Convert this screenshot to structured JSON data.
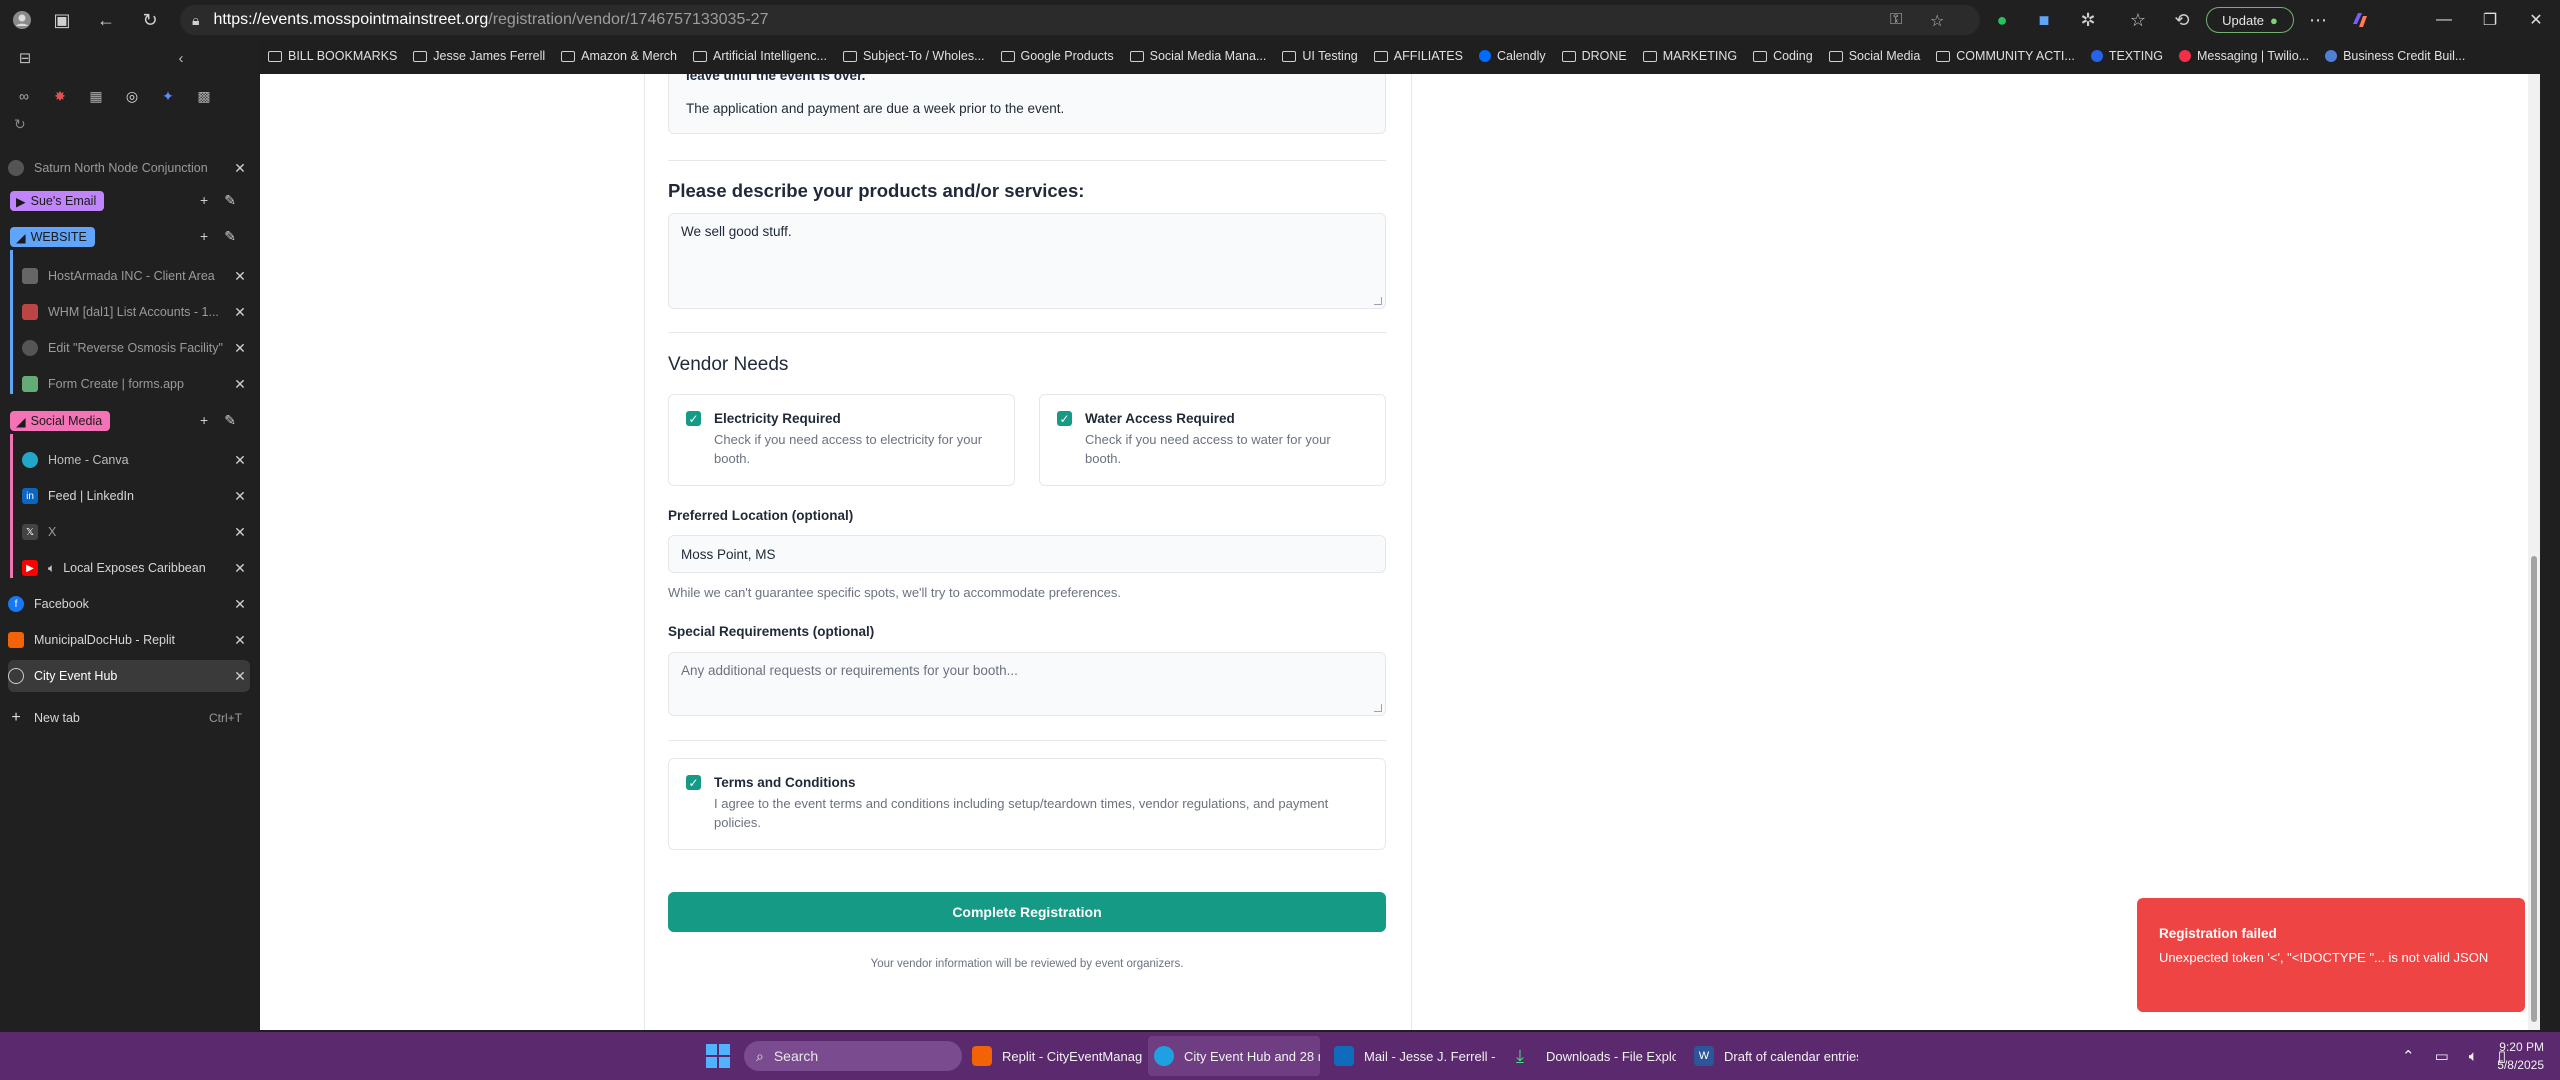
{
  "browser": {
    "url_host": "https://events.mosspointmainstreet.org",
    "url_path": "/registration/vendor/1746757133035-27",
    "update_label": "Update"
  },
  "bookmarks": [
    {
      "label": "BILL BOOKMARKS",
      "icon": "folder-icon"
    },
    {
      "label": "Jesse James Ferrell",
      "icon": "folder-icon"
    },
    {
      "label": "Amazon & Merch",
      "icon": "folder-icon"
    },
    {
      "label": "Artificial Intelligenc...",
      "icon": "folder-icon"
    },
    {
      "label": "Subject-To / Wholes...",
      "icon": "folder-icon"
    },
    {
      "label": "Google Products",
      "icon": "folder-icon"
    },
    {
      "label": "Social Media Mana...",
      "icon": "folder-icon"
    },
    {
      "label": "UI Testing",
      "icon": "folder-icon"
    },
    {
      "label": "AFFILIATES",
      "icon": "folder-icon"
    },
    {
      "label": "Calendly",
      "icon": "calendly-icon"
    },
    {
      "label": "DRONE",
      "icon": "folder-icon"
    },
    {
      "label": "MARKETING",
      "icon": "folder-icon"
    },
    {
      "label": "Coding",
      "icon": "folder-icon"
    },
    {
      "label": "Social Media",
      "icon": "folder-icon"
    },
    {
      "label": "COMMUNITY ACTI...",
      "icon": "folder-icon"
    },
    {
      "label": "TEXTING",
      "icon": "texting-icon"
    },
    {
      "label": "Messaging | Twilio...",
      "icon": "twilio-icon"
    },
    {
      "label": "Business Credit Buil...",
      "icon": "credit-icon"
    }
  ],
  "sidebar": {
    "tab_saturn": "Saturn North Node Conjunction",
    "group_sue": "Sue's Email",
    "group_website": "WEBSITE",
    "tab_hostarmada": "HostArmada INC - Client Area",
    "tab_whm": "WHM [dal1] List Accounts - 1...",
    "tab_edit": "Edit \"Reverse Osmosis Facility\"",
    "tab_formcreate": "Form Create | forms.app",
    "group_social": "Social Media",
    "tab_canva": "Home - Canva",
    "tab_linkedin": "Feed | LinkedIn",
    "tab_x": "X",
    "tab_youtube": "Local Exposes Caribbean",
    "tab_facebook": "Facebook",
    "tab_municipal": "MunicipalDocHub - Replit",
    "tab_city": "City Event Hub",
    "new_tab": "New tab",
    "new_tab_shortcut": "Ctrl+T",
    "colors": {
      "sue": "#c084fc",
      "website": "#60a5fa",
      "social": "#f472b6"
    }
  },
  "form": {
    "notice_cut": "leave until the event is over.",
    "notice_text": "The application and payment are due a week prior to the event.",
    "products_heading": "Please describe your products and/or services:",
    "products_value": "We sell good stuff.",
    "vendor_needs_heading": "Vendor Needs",
    "electricity_title": "Electricity Required",
    "electricity_desc": "Check if you need access to electricity for your booth.",
    "electricity_checked": true,
    "water_title": "Water Access Required",
    "water_desc": "Check if you need access to water for your booth.",
    "water_checked": true,
    "location_label": "Preferred Location (optional)",
    "location_value": "Moss Point, MS",
    "location_helper": "While we can't guarantee specific spots, we'll try to accommodate preferences.",
    "special_label": "Special Requirements (optional)",
    "special_placeholder": "Any additional requests or requirements for your booth...",
    "terms_title": "Terms and Conditions",
    "terms_desc": "I agree to the event terms and conditions including setup/teardown times, vendor regulations, and payment policies.",
    "terms_checked": true,
    "submit_label": "Complete Registration",
    "footnote": "Your vendor information will be reviewed by event organizers.",
    "accent_color": "#159a86"
  },
  "toast": {
    "title": "Registration failed",
    "message": "Unexpected token '<', \"<!DOCTYPE \"... is not valid JSON",
    "color": "#ef4444"
  },
  "taskbar": {
    "search": "Search",
    "apps": [
      "Replit - CityEventManag",
      "City Event Hub and 28 r",
      "Mail - Jesse J. Ferrell - C",
      "Downloads - File Explor",
      "Draft of calendar entries"
    ],
    "time": "9:20 PM",
    "date": "5/8/2025"
  }
}
